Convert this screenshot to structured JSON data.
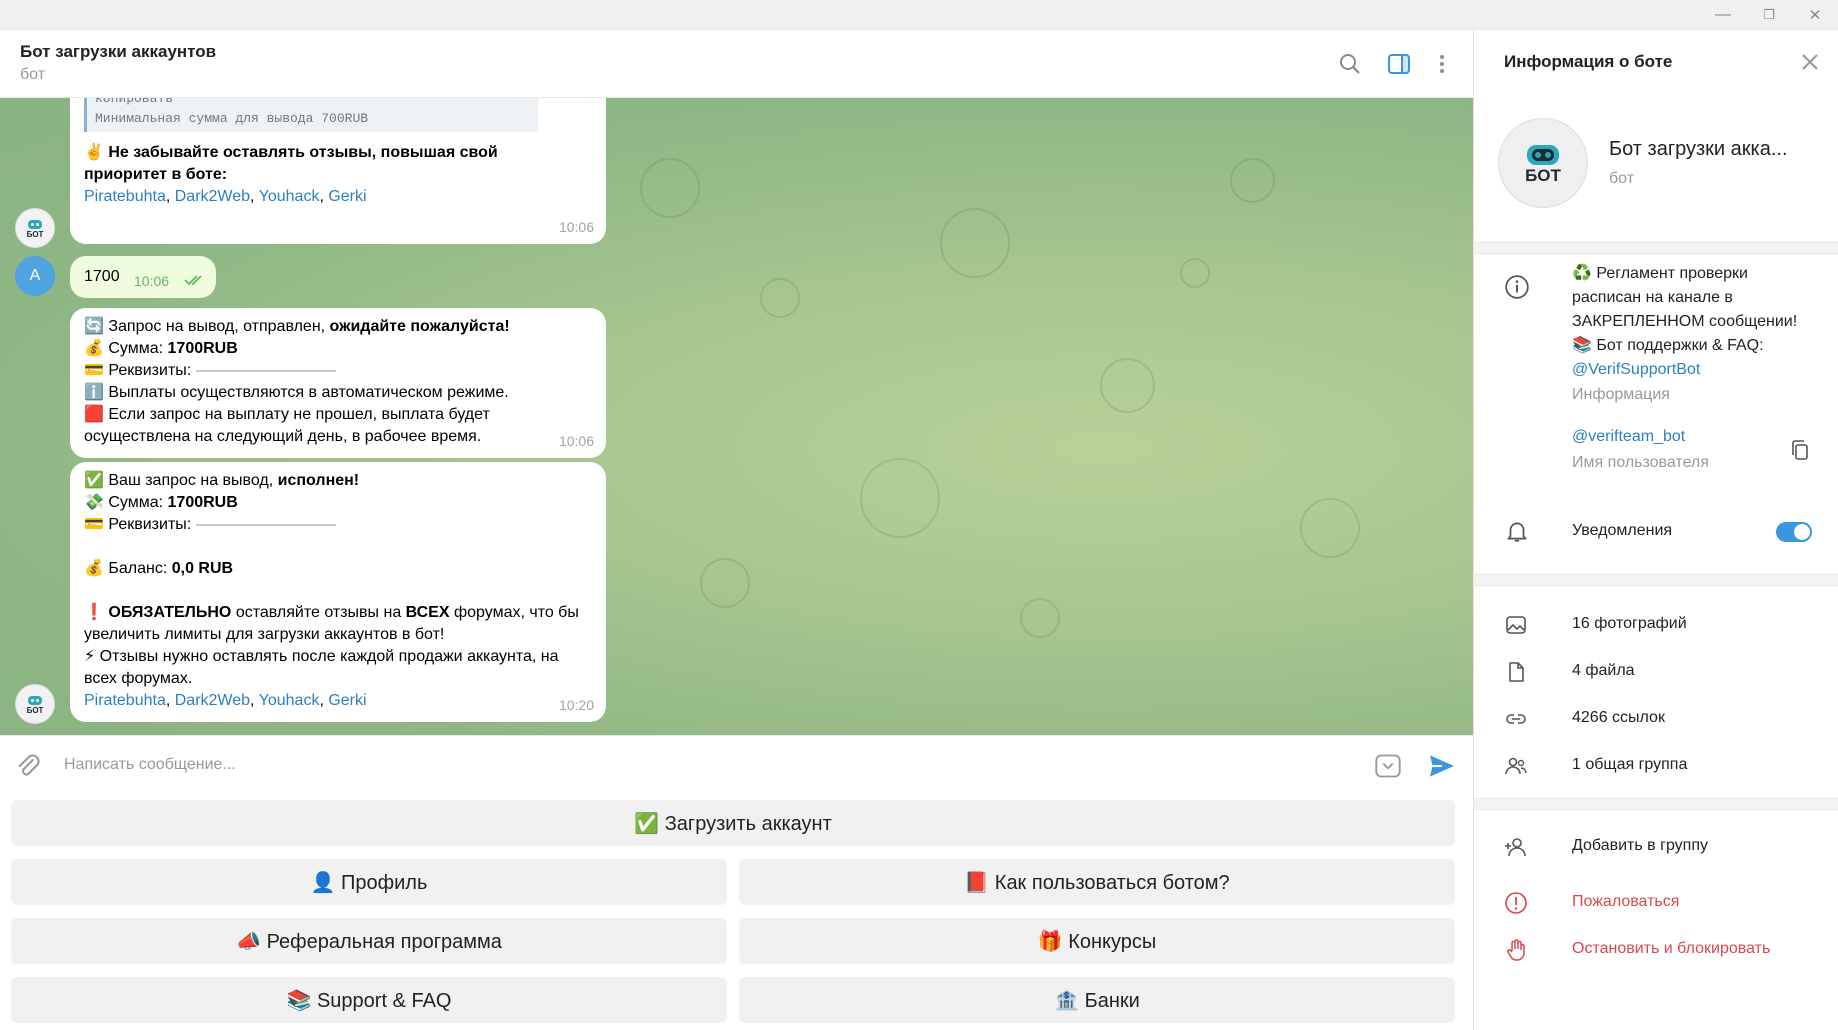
{
  "window": {
    "minimize": "—",
    "restore": "❐",
    "close": "✕"
  },
  "chat": {
    "title": "Бот загрузки аккаунтов",
    "subtitle": "бот",
    "icons": [
      "search-icon",
      "sidebar-toggle-icon",
      "more-vertical-icon"
    ]
  },
  "messages": {
    "m1": {
      "code_line1": "копировать",
      "code_line2": "Минимальная сумма для вывода 700RUB",
      "text_line1": "✌️ Не забывайте оставлять отзывы, повышая свой",
      "text_line2": "приоритет в боте:",
      "links": [
        "Piratebuhta",
        "Dark2Web",
        "Youhack",
        "Gerki"
      ],
      "time": "10:06"
    },
    "m2": {
      "text": "1700",
      "time": "10:06",
      "avatar_letter": "A"
    },
    "m3": {
      "l1_pre": "🔄 Запрос на вывод,  отправлен, ",
      "l1_bold": "ожидайте пожалуйста!",
      "l2_pre": "💰 Сумма: ",
      "l2_bold": "1700RUB",
      "l3": "💳 Реквизиты: ",
      "l4": "ℹ️ Выплаты осуществляются в автоматическом режиме.",
      "l5": "🟥 Если запрос на выплату не прошел, выплата будет",
      "l6": "осуществлена на следующий день, в рабочее время.",
      "time": "10:06"
    },
    "m4": {
      "l1_pre": "✅ Ваш запрос на вывод, ",
      "l1_bold": "исполнен!",
      "l2_pre": "💸 Сумма: ",
      "l2_bold": "1700RUB",
      "l3": "💳 Реквизиты: ",
      "l4_pre": "💰 Баланс: ",
      "l4_bold": "0,0 RUB",
      "l5_bold1": "❗ ОБЯЗАТЕЛЬНО",
      "l5_mid": " оставляйте отзывы на ",
      "l5_bold2": "ВСЕХ",
      "l5_post": " форумах, что бы",
      "l6": "увеличить лимиты для загрузки аккаунтов в бот!",
      "l7": "⚡ Отзывы нужно оставлять после каждой продажи аккаунта, на",
      "l8": "всех форумах.",
      "links": [
        "Piratebuhta",
        "Dark2Web",
        "Youhack",
        "Gerki"
      ],
      "time": "10:20"
    },
    "bot_avatar_text": "БОТ"
  },
  "input": {
    "placeholder": "Написать сообщение..."
  },
  "keyboard": {
    "b1": "✅ Загрузить аккаунт",
    "b2": "👤 Профиль",
    "b3": "📕 Как пользоваться ботом?",
    "b4": "📣 Реферальная программа",
    "b5": "🎁 Конкурсы",
    "b6": "📚 Support & FAQ",
    "b7": "🏦 Банки"
  },
  "side": {
    "header": "Информация о боте",
    "name": "Бот загрузки акка...",
    "type": "бот",
    "avatar_text": "БОТ",
    "info_l1": "♻️ Регламент проверки",
    "info_l2": "расписан на канале в",
    "info_l3": "ЗАКРЕПЛЕННОМ сообщении!",
    "info_l4": "📚 Бот поддержки & FAQ:",
    "info_link": "@VerifSupportBot",
    "info_caption": "Информация",
    "username": "@verifteam_bot",
    "username_caption": "Имя пользователя",
    "notifications": "Уведомления",
    "notifications_on": true,
    "media": [
      "16 фотографий",
      "4 файла",
      "4266 ссылок",
      "1 общая группа"
    ],
    "add_group": "Добавить в группу",
    "report": "Пожаловаться",
    "block": "Остановить и блокировать",
    "accent": "#3a96dd",
    "danger": "#d9484e"
  }
}
